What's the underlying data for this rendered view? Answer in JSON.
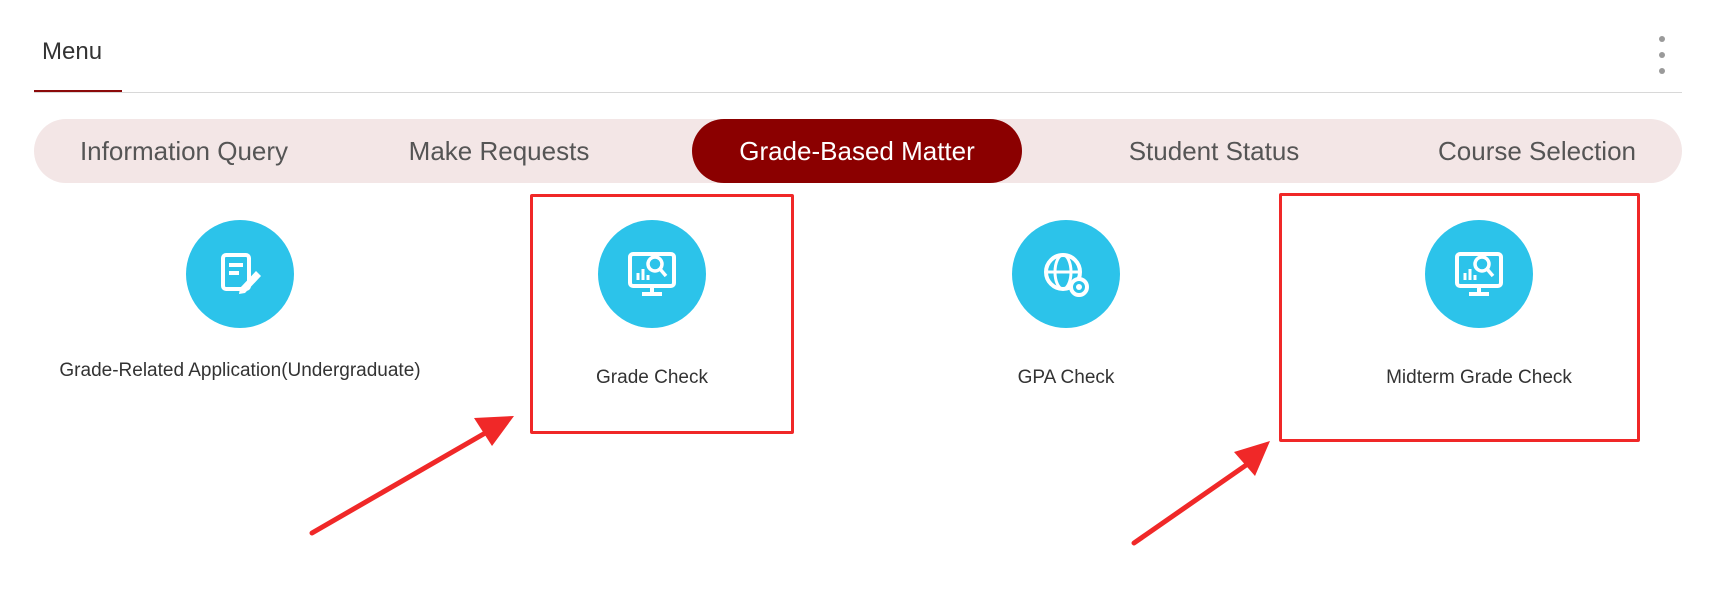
{
  "menu": {
    "title": "Menu"
  },
  "tabs": [
    {
      "label": "Information Query",
      "active": false
    },
    {
      "label": "Make Requests",
      "active": false
    },
    {
      "label": "Grade-Based Matter",
      "active": true
    },
    {
      "label": "Student Status",
      "active": false
    },
    {
      "label": "Course Selection",
      "active": false
    }
  ],
  "items": [
    {
      "label": "Grade-Related Application(Undergraduate)",
      "icon": "edit-document-icon"
    },
    {
      "label": "Grade Check",
      "icon": "monitor-search-icon"
    },
    {
      "label": "GPA Check",
      "icon": "gpa-gear-icon"
    },
    {
      "label": "Midterm Grade Check",
      "icon": "monitor-search-icon"
    }
  ],
  "colors": {
    "accent": "#8b0000",
    "tab_bar_bg": "#f3e6e6",
    "icon_bg": "#2cc3ea",
    "annotation": "#f02828"
  }
}
